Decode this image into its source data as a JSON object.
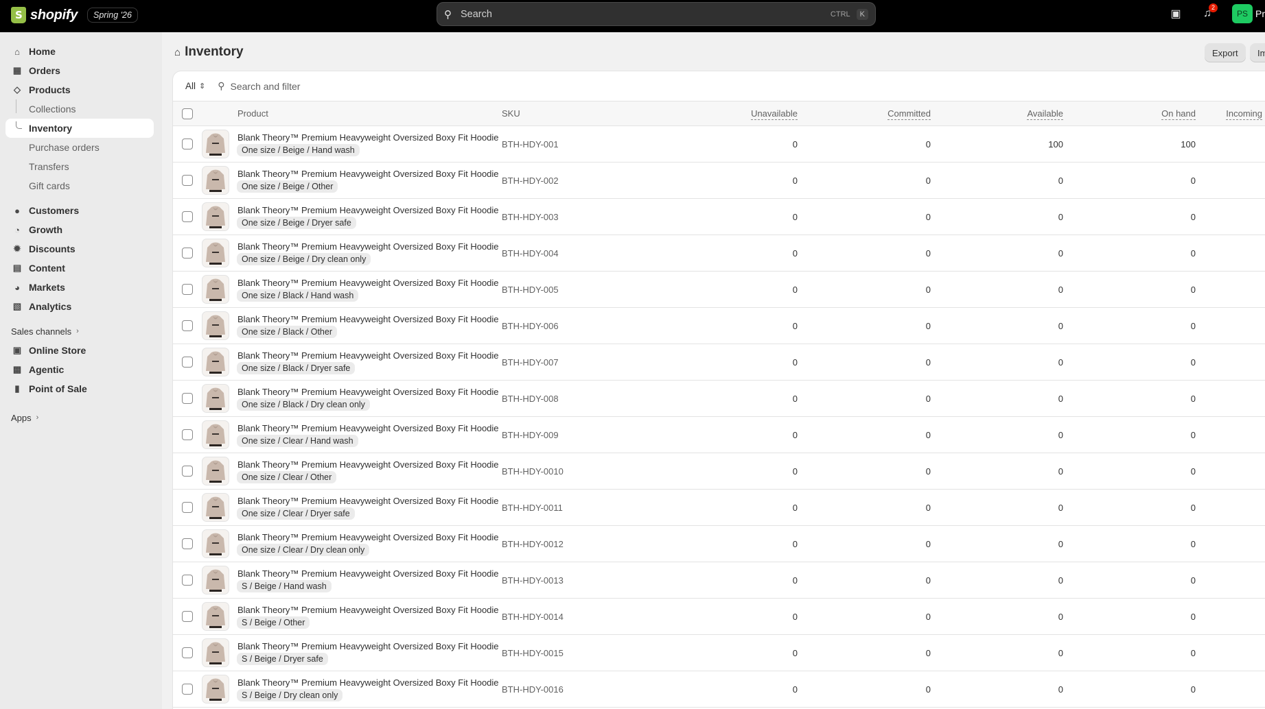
{
  "topbar": {
    "logo_text": "shopify",
    "edition": "Spring '26",
    "search_label": "Search",
    "shortcut_ctrl": "CTRL",
    "shortcut_key": "K",
    "notification_count": "2",
    "avatar_initials": "PS",
    "avatar_name": "Pr"
  },
  "sidebar": {
    "items": [
      {
        "label": "Home",
        "icon": "home-icon"
      },
      {
        "label": "Orders",
        "icon": "inbox-icon"
      },
      {
        "label": "Products",
        "icon": "tag-icon"
      }
    ],
    "product_subitems": [
      {
        "label": "Collections"
      },
      {
        "label": "Inventory",
        "active": true
      },
      {
        "label": "Purchase orders"
      },
      {
        "label": "Transfers"
      },
      {
        "label": "Gift cards"
      }
    ],
    "items2": [
      {
        "label": "Customers",
        "icon": "person-icon"
      },
      {
        "label": "Growth",
        "icon": "gauge-icon"
      },
      {
        "label": "Discounts",
        "icon": "discount-icon"
      },
      {
        "label": "Content",
        "icon": "content-icon"
      },
      {
        "label": "Markets",
        "icon": "globe-icon"
      },
      {
        "label": "Analytics",
        "icon": "bar-chart-icon"
      }
    ],
    "sales_channels_label": "Sales channels",
    "channels": [
      {
        "label": "Online Store",
        "icon": "store-icon"
      },
      {
        "label": "Agentic",
        "icon": "agent-icon"
      },
      {
        "label": "Point of Sale",
        "icon": "pos-icon"
      }
    ],
    "apps_label": "Apps"
  },
  "page": {
    "title": "Inventory",
    "export_label": "Export",
    "import_label": "Import"
  },
  "filter": {
    "tab_all": "All",
    "search_placeholder": "Search and filter"
  },
  "table": {
    "columns": {
      "product": "Product",
      "sku": "SKU",
      "unavailable": "Unavailable",
      "committed": "Committed",
      "available": "Available",
      "on_hand": "On hand",
      "incoming": "Incoming"
    },
    "rows": [
      {
        "name": "Blank Theory™ Premium Heavyweight Oversized Boxy Fit Hoodie",
        "variant": "One size / Beige / Hand wash",
        "sku": "BTH-HDY-001",
        "unavailable": "0",
        "committed": "0",
        "available": "100",
        "on_hand": "100"
      },
      {
        "name": "Blank Theory™ Premium Heavyweight Oversized Boxy Fit Hoodie",
        "variant": "One size / Beige / Other",
        "sku": "BTH-HDY-002",
        "unavailable": "0",
        "committed": "0",
        "available": "0",
        "on_hand": "0"
      },
      {
        "name": "Blank Theory™ Premium Heavyweight Oversized Boxy Fit Hoodie",
        "variant": "One size / Beige / Dryer safe",
        "sku": "BTH-HDY-003",
        "unavailable": "0",
        "committed": "0",
        "available": "0",
        "on_hand": "0"
      },
      {
        "name": "Blank Theory™ Premium Heavyweight Oversized Boxy Fit Hoodie",
        "variant": "One size / Beige / Dry clean only",
        "sku": "BTH-HDY-004",
        "unavailable": "0",
        "committed": "0",
        "available": "0",
        "on_hand": "0"
      },
      {
        "name": "Blank Theory™ Premium Heavyweight Oversized Boxy Fit Hoodie",
        "variant": "One size / Black / Hand wash",
        "sku": "BTH-HDY-005",
        "unavailable": "0",
        "committed": "0",
        "available": "0",
        "on_hand": "0"
      },
      {
        "name": "Blank Theory™ Premium Heavyweight Oversized Boxy Fit Hoodie",
        "variant": "One size / Black / Other",
        "sku": "BTH-HDY-006",
        "unavailable": "0",
        "committed": "0",
        "available": "0",
        "on_hand": "0"
      },
      {
        "name": "Blank Theory™ Premium Heavyweight Oversized Boxy Fit Hoodie",
        "variant": "One size / Black / Dryer safe",
        "sku": "BTH-HDY-007",
        "unavailable": "0",
        "committed": "0",
        "available": "0",
        "on_hand": "0"
      },
      {
        "name": "Blank Theory™ Premium Heavyweight Oversized Boxy Fit Hoodie",
        "variant": "One size / Black / Dry clean only",
        "sku": "BTH-HDY-008",
        "unavailable": "0",
        "committed": "0",
        "available": "0",
        "on_hand": "0"
      },
      {
        "name": "Blank Theory™ Premium Heavyweight Oversized Boxy Fit Hoodie",
        "variant": "One size / Clear / Hand wash",
        "sku": "BTH-HDY-009",
        "unavailable": "0",
        "committed": "0",
        "available": "0",
        "on_hand": "0"
      },
      {
        "name": "Blank Theory™ Premium Heavyweight Oversized Boxy Fit Hoodie",
        "variant": "One size / Clear / Other",
        "sku": "BTH-HDY-0010",
        "unavailable": "0",
        "committed": "0",
        "available": "0",
        "on_hand": "0"
      },
      {
        "name": "Blank Theory™ Premium Heavyweight Oversized Boxy Fit Hoodie",
        "variant": "One size / Clear / Dryer safe",
        "sku": "BTH-HDY-0011",
        "unavailable": "0",
        "committed": "0",
        "available": "0",
        "on_hand": "0"
      },
      {
        "name": "Blank Theory™ Premium Heavyweight Oversized Boxy Fit Hoodie",
        "variant": "One size / Clear / Dry clean only",
        "sku": "BTH-HDY-0012",
        "unavailable": "0",
        "committed": "0",
        "available": "0",
        "on_hand": "0"
      },
      {
        "name": "Blank Theory™ Premium Heavyweight Oversized Boxy Fit Hoodie",
        "variant": "S / Beige / Hand wash",
        "sku": "BTH-HDY-0013",
        "unavailable": "0",
        "committed": "0",
        "available": "0",
        "on_hand": "0"
      },
      {
        "name": "Blank Theory™ Premium Heavyweight Oversized Boxy Fit Hoodie",
        "variant": "S / Beige / Other",
        "sku": "BTH-HDY-0014",
        "unavailable": "0",
        "committed": "0",
        "available": "0",
        "on_hand": "0"
      },
      {
        "name": "Blank Theory™ Premium Heavyweight Oversized Boxy Fit Hoodie",
        "variant": "S / Beige / Dryer safe",
        "sku": "BTH-HDY-0015",
        "unavailable": "0",
        "committed": "0",
        "available": "0",
        "on_hand": "0"
      },
      {
        "name": "Blank Theory™ Premium Heavyweight Oversized Boxy Fit Hoodie",
        "variant": "S / Beige / Dry clean only",
        "sku": "BTH-HDY-0016",
        "unavailable": "0",
        "committed": "0",
        "available": "0",
        "on_hand": "0"
      }
    ]
  }
}
